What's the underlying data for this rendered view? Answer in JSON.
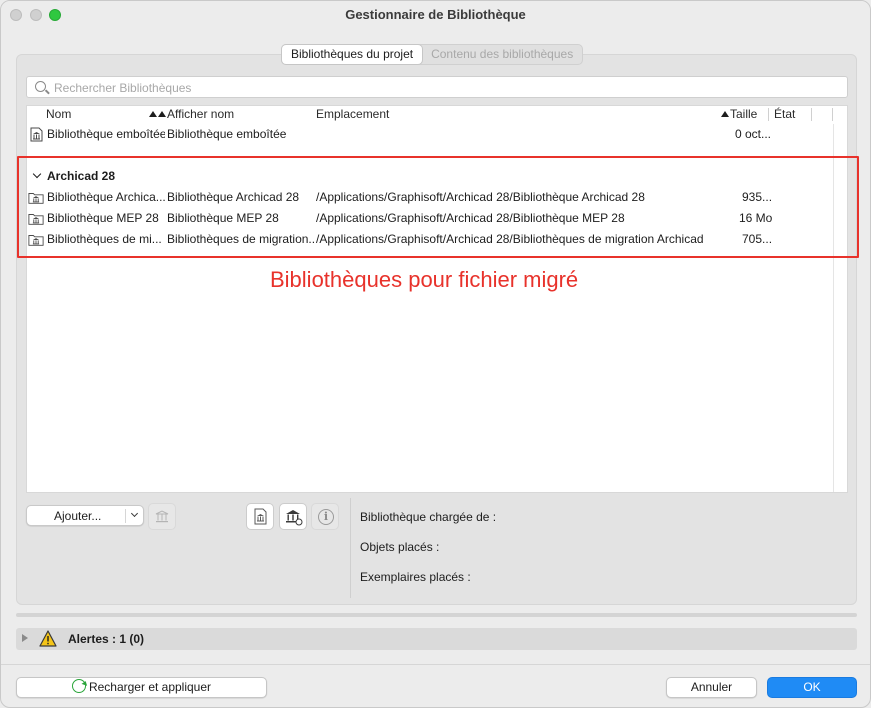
{
  "window": {
    "title": "Gestionnaire de Bibliothèque"
  },
  "tabs": [
    {
      "label": "Bibliothèques du projet",
      "active": true
    },
    {
      "label": "Contenu des bibliothèques",
      "active": false
    }
  ],
  "search": {
    "placeholder": "Rechercher Bibliothèques"
  },
  "columns": {
    "name": "Nom",
    "display_name": "Afficher nom",
    "location": "Emplacement",
    "size": "Taille",
    "state": "État"
  },
  "rows": [
    {
      "name": "Bibliothèque emboîtée",
      "display_name": "Bibliothèque emboîtée",
      "location": "",
      "size": "0 oct...",
      "icon": "embedded-library-icon"
    }
  ],
  "group": {
    "title": "Archicad 28",
    "rows": [
      {
        "name": "Bibliothèque Archica...",
        "display_name": "Bibliothèque Archicad 28",
        "location": "/Applications/Graphisoft/Archicad 28/Bibliothèque Archicad 28",
        "size": "935...",
        "icon": "library-folder-icon"
      },
      {
        "name": "Bibliothèque MEP 28",
        "display_name": "Bibliothèque MEP 28",
        "location": "/Applications/Graphisoft/Archicad 28/Bibliothèque MEP 28",
        "size": "16 Mo",
        "icon": "library-folder-icon"
      },
      {
        "name": "Bibliothèques de mi...",
        "display_name": "Bibliothèques de migration...",
        "location": "/Applications/Graphisoft/Archicad 28/Bibliothèques de migration Archicad",
        "size": "705...",
        "icon": "library-folder-icon"
      }
    ]
  },
  "annotation": {
    "text": "Bibliothèques pour fichier migré",
    "color": "#e8322b"
  },
  "controls": {
    "add_label": "Ajouter..."
  },
  "info": {
    "loaded_from": "Bibliothèque chargée de :",
    "placed_objects": "Objets placés :",
    "placed_instances": "Exemplaires placés :"
  },
  "alerts": {
    "label": "Alertes : 1 (0)"
  },
  "footer": {
    "reload_label": "Recharger et appliquer",
    "cancel_label": "Annuler",
    "ok_label": "OK"
  },
  "colors": {
    "accent": "#1f8bf5",
    "highlight": "#e8322b"
  }
}
